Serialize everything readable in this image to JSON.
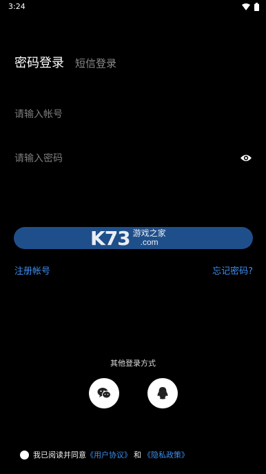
{
  "status": {
    "time": "3:24"
  },
  "tabs": {
    "password_login": "密码登录",
    "sms_login": "短信登录"
  },
  "form": {
    "account_placeholder": "请输入帐号",
    "password_placeholder": "请输入密码"
  },
  "login_button": {
    "watermark_big": "K73",
    "watermark_cn": "游戏之家",
    "watermark_domain": ".com"
  },
  "links": {
    "register": "注册帐号",
    "forgot": "忘记密码?"
  },
  "other_login": {
    "title": "其他登录方式",
    "icons": [
      "wechat-icon",
      "qq-icon"
    ]
  },
  "agreement": {
    "prefix": "我已阅读并同意",
    "user_agreement": "《用户协议》",
    "and": "和",
    "privacy_policy": "《隐私政策》"
  },
  "colors": {
    "background": "#000000",
    "accent": "#3e8ef0",
    "button": "#1f4f8a"
  }
}
